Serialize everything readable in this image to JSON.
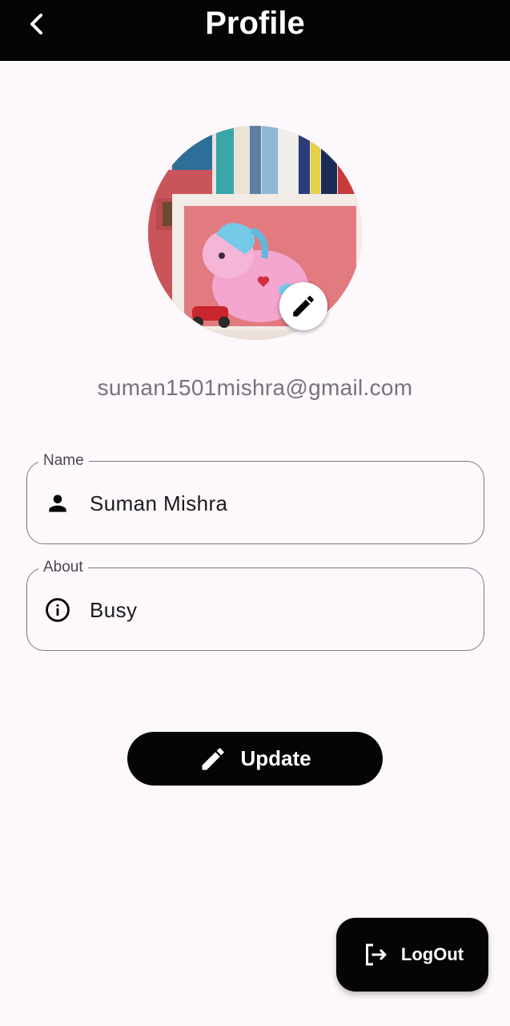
{
  "appbar": {
    "title": "Profile",
    "back_icon": "chevron-left-icon"
  },
  "profile": {
    "avatar_alt": "profile photo",
    "edit_photo_icon": "pencil-icon",
    "email": "suman1501mishra@gmail.com"
  },
  "form": {
    "name": {
      "label": "Name",
      "value": "Suman Mishra",
      "icon": "person-icon"
    },
    "about": {
      "label": "About",
      "value": "Busy",
      "icon": "info-icon"
    }
  },
  "actions": {
    "update_label": "Update",
    "update_icon": "pencil-icon",
    "logout_label": "LogOut",
    "logout_icon": "logout-icon"
  },
  "colors": {
    "appbar_bg": "#050406",
    "page_bg": "#fdf8fc",
    "button_bg": "#050406",
    "email_text": "#77737a",
    "field_border": "#7d787f"
  }
}
